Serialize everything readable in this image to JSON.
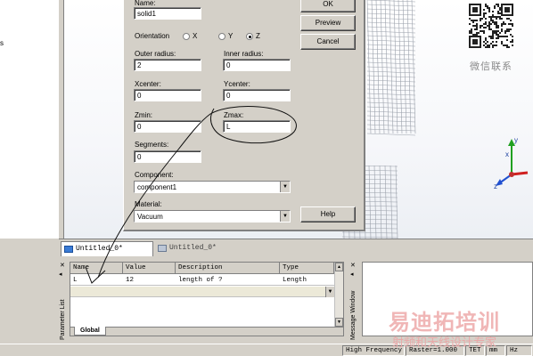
{
  "left_text": "s",
  "dialog": {
    "name_label": "Name:",
    "name_value": "solid1",
    "orientation_label": "Orientation",
    "orient_x": "X",
    "orient_y": "Y",
    "orient_z": "Z",
    "orientation_selected": "Z",
    "outer_radius_label": "Outer radius:",
    "outer_radius_value": "2",
    "inner_radius_label": "Inner radius:",
    "inner_radius_value": "0",
    "xcenter_label": "Xcenter:",
    "xcenter_value": "0",
    "ycenter_label": "Ycenter:",
    "ycenter_value": "0",
    "zmin_label": "Zmin:",
    "zmin_value": "0",
    "zmax_label": "Zmax:",
    "zmax_value": "L",
    "segments_label": "Segments:",
    "segments_value": "0",
    "component_label": "Component:",
    "component_value": "component1",
    "material_label": "Material:",
    "material_value": "Vacuum",
    "ok_label": "OK",
    "preview_label": "Preview",
    "cancel_label": "Cancel",
    "help_label": "Help"
  },
  "qr_caption": "微信联系",
  "tabs": [
    {
      "label": "Untitled_0*",
      "active": true
    },
    {
      "label": "Untitled_0*",
      "active": false
    }
  ],
  "parameter_list": {
    "side_label": "Parameter List",
    "headers": [
      "Name",
      "Value",
      "Description",
      "Type"
    ],
    "rows": [
      {
        "name": "L",
        "value": "12",
        "description": "length of ?",
        "type": "Length"
      }
    ],
    "tab_label": "Global"
  },
  "message_window": {
    "side_label": "Message Window"
  },
  "status": {
    "mode": "High Frequency",
    "raster": "Raster=1.000",
    "tet": "TET",
    "unit1": "mm",
    "unit2": "Hz"
  },
  "watermark": {
    "line1": "易迪拓培训",
    "line2": "射频和天线设计专家"
  },
  "colors": {
    "axis_x": "#d02020",
    "axis_y": "#20a020",
    "axis_z": "#2050d0",
    "watermark": "#f0b6b6"
  }
}
